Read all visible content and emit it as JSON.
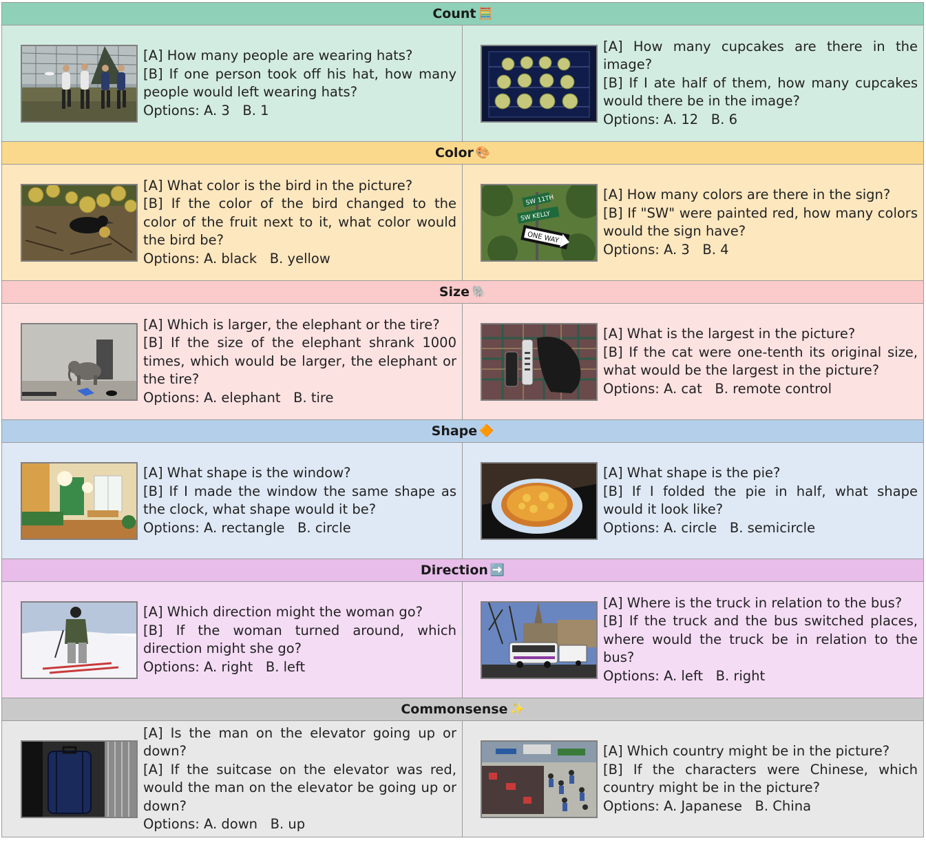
{
  "sections": [
    {
      "title": "Count",
      "emoji": "🧮",
      "bg": "#d3ece2",
      "header_bg": "#8fd0b8",
      "items": [
        {
          "image": "people-frisbee-photo",
          "a": "[A] How many people are wearing hats?",
          "b": "[B] If one person took off his hat, how many people would left wearing hats?",
          "options": "Options: A. 3   B. 1"
        },
        {
          "image": "cupcakes-photo",
          "a": "[A] How many cupcakes are there in the image?",
          "b": "[B] If I ate half of them, how many cupcakes would there be in the image?",
          "options": "Options: A. 12   B. 6"
        }
      ]
    },
    {
      "title": "Color",
      "emoji": "🎨",
      "bg": "#fde7bf",
      "header_bg": "#fbd98c",
      "items": [
        {
          "image": "bird-fruit-photo",
          "a": "[A] What color is the bird in the picture?",
          "b": "[B] If the color of the bird changed to the color of the fruit next to it, what color would the bird be?",
          "options": "Options: A. black   B. yellow"
        },
        {
          "image": "street-sign-photo",
          "a": "[A] How many colors are there in the sign?",
          "b": "[B] If \"SW\" were painted red, how many colors would the sign have?",
          "options": "Options: A. 3   B. 4"
        }
      ]
    },
    {
      "title": "Size",
      "emoji": "🐘",
      "bg": "#fde2e2",
      "header_bg": "#fbcaca",
      "items": [
        {
          "image": "elephant-tire-photo",
          "a": "[A] Which is larger, the elephant or the tire?",
          "b": "[B] If the size of the elephant shrank 1000 times, which would be larger, the elephant or the tire?",
          "options": "Options: A. elephant   B. tire"
        },
        {
          "image": "cat-remote-photo",
          "a": "[A] What is the largest in the picture?",
          "b": "[B] If the cat were one-tenth its original size, what would be the largest in the picture?",
          "options": "Options: A. cat   B. remote control"
        }
      ]
    },
    {
      "title": "Shape",
      "emoji": "🔶",
      "bg": "#dfe9f5",
      "header_bg": "#b4cfea",
      "items": [
        {
          "image": "kitchen-window-photo",
          "a": "[A] What shape is the window?",
          "b": "[B] If I made the window the same shape as the clock, what shape would it be?",
          "options": "Options: A. rectangle   B. circle"
        },
        {
          "image": "pie-photo",
          "a": "[A] What shape is the pie?",
          "b": "[B] If I folded the pie in half, what shape would it look like?",
          "options": "Options: A. circle   B. semicircle"
        }
      ]
    },
    {
      "title": "Direction",
      "emoji": "➡️",
      "bg": "#f5dcf5",
      "header_bg": "#e8bdea",
      "items": [
        {
          "image": "skier-photo",
          "a": "[A] Which direction might the woman go?",
          "b": "[B] If the woman turned around, which direction might she go?",
          "options": "Options: A. right   B. left"
        },
        {
          "image": "bus-truck-photo",
          "a": "[A] Where is the truck in relation to the bus?",
          "b": "[B] If the truck and the bus switched places, where would the truck be in relation to the bus?",
          "options": "Options: A. left   B. right"
        }
      ]
    },
    {
      "title": "Commonsense",
      "emoji": "✨",
      "bg": "#e8e8e8",
      "header_bg": "#c9c9c9",
      "items": [
        {
          "image": "suitcase-elevator-photo",
          "a": "[A] Is the man on the elevator going up or down?",
          "b": "[A] If the suitcase on the elevator was red, would the man on the elevator be going up or down?",
          "options": "Options: A. down   B. up"
        },
        {
          "image": "market-crowd-photo",
          "a": "[A] Which country might be in the picture?",
          "b": "[B] If the characters were Chinese, which country might be in the picture?",
          "options": "Options: A. Japanese   B. China"
        }
      ]
    }
  ]
}
